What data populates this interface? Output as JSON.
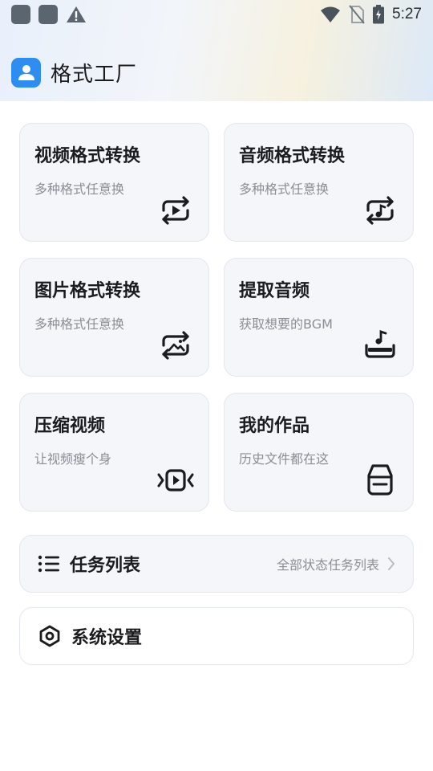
{
  "status_bar": {
    "time": "5:27",
    "icons": [
      "app-notification-icon",
      "app-notification-icon",
      "warning-icon",
      "wifi-icon",
      "no-sim-icon",
      "battery-charging-icon"
    ]
  },
  "app": {
    "title": "格式工厂",
    "logo_icon": "user-icon"
  },
  "cards": [
    {
      "title": "视频格式转换",
      "subtitle": "多种格式任意换",
      "icon": "video-convert-icon"
    },
    {
      "title": "音频格式转换",
      "subtitle": "多种格式任意换",
      "icon": "audio-convert-icon"
    },
    {
      "title": "图片格式转换",
      "subtitle": "多种格式任意换",
      "icon": "image-convert-icon"
    },
    {
      "title": "提取音频",
      "subtitle": "获取想要的BGM",
      "icon": "extract-audio-icon"
    },
    {
      "title": "压缩视频",
      "subtitle": "让视频瘦个身",
      "icon": "compress-video-icon"
    },
    {
      "title": "我的作品",
      "subtitle": "历史文件都在这",
      "icon": "inbox-icon"
    }
  ],
  "tasks_row": {
    "title": "任务列表",
    "hint": "全部状态任务列表",
    "icon": "list-icon"
  },
  "settings_row": {
    "title": "系统设置",
    "icon": "settings-icon"
  },
  "colors": {
    "brand": "#2d8df0",
    "card_bg": "#f4f6fa",
    "text": "#1c1c1e",
    "muted": "#8b8e95"
  }
}
